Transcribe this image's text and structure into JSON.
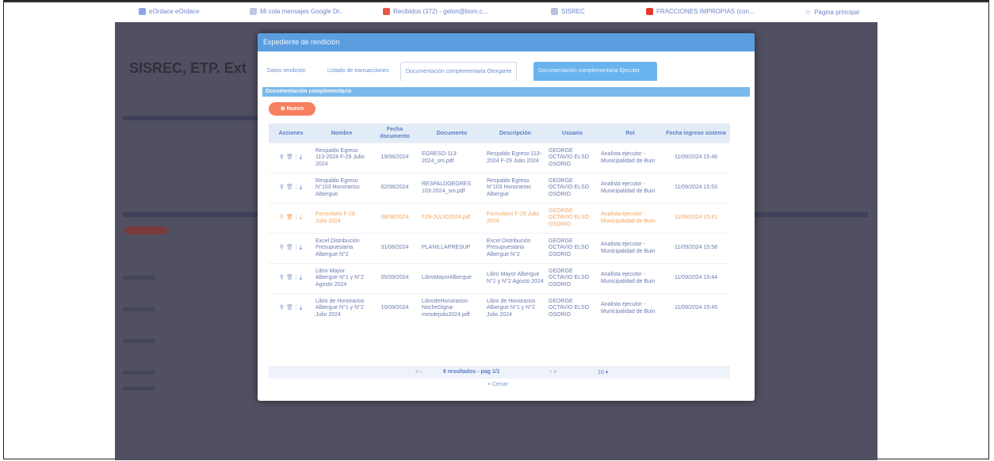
{
  "bookmarks": [
    {
      "label": "eOrdace eOrdace",
      "icon": "folder-icon",
      "color": "#8fa6e6"
    },
    {
      "label": "Mi cola mensajes  Google Dr..",
      "icon": "doc-icon",
      "color": "#c0c8e8"
    },
    {
      "label": "Recibidos (372) - gelon@bom.c...",
      "icon": "mail-icon",
      "color": "#e8584a"
    },
    {
      "label": "SISREC",
      "icon": "link-icon",
      "color": "#b8c2de"
    },
    {
      "label": "FRACCIONES IMPROPIAS (con...",
      "icon": "youtube-icon",
      "color": "#e63a2a"
    },
    {
      "label": "Página principal",
      "icon": "star-icon",
      "color": "#9fb2e6"
    }
  ],
  "backdrop": {
    "title": "SISREC, ETP. Ext"
  },
  "modal": {
    "title": "Expediente de rendición",
    "tabs": [
      {
        "label": "Datos rendición"
      },
      {
        "label": "Listado de transacciones"
      },
      {
        "label": "Documentación complementaria Otorgante"
      },
      {
        "label": "Documentación complementaria Ejecutor"
      }
    ],
    "section_title": "Documentación complementaria",
    "new_button": "Nuevo",
    "table": {
      "headers": [
        "Acciones",
        "Nombre",
        "Fecha documento",
        "Documento",
        "Descripción",
        "Usuario",
        "Rol",
        "Fecha ingreso sistema"
      ],
      "rows": [
        {
          "nombre": "Respaldo Egreso 113-2024 F-29 Julio 2024",
          "fecha": "19/08/2024",
          "documento": "EGRESO-113-2024_sm.pdf",
          "descripcion": "Respaldo Egreso 113-2024 F-29 Julio 2024",
          "usuario": "GEORGE OCTAVIO ELSO OSORIO",
          "rol": "Analista ejecutor - Municipalidad de Buin",
          "ingreso": "11/09/2024 15:46"
        },
        {
          "nombre": "Respaldo Egreso N°103 Honorarios Albergue",
          "fecha": "02/08/2024",
          "documento": "RESPALDOEGRES 103-2024_sm.pdf",
          "descripcion": "Respaldo Egreso N°103 Honorarios Albergue",
          "usuario": "GEORGE OCTAVIO ELSO OSORIO",
          "rol": "Analista ejecutor - Municipalidad de Buin",
          "ingreso": "11/09/2024 15:53"
        },
        {
          "nombre": "Formulario F-29 Julio 2024",
          "fecha": "08/08/2024",
          "documento": "F29-JULIO2024.pdf",
          "descripcion": "Formulario F-29 Julio 2024",
          "usuario": "GEORGE OCTAVIO ELSO OSORIO",
          "rol": "Analista ejecutor - Municipalidad de Buin",
          "ingreso": "11/09/2024 15:41"
        },
        {
          "nombre": "Excel Distribución Presupuestaria Albergue N°2",
          "fecha": "31/08/2024",
          "documento": "PLANILLAPRESUP",
          "descripcion": "Excel Distribución Presupuestaria Albergue N°2",
          "usuario": "GEORGE OCTAVIO ELSO OSORIO",
          "rol": "Analista ejecutor - Municipalidad de Buin",
          "ingreso": "11/09/2024 15:58"
        },
        {
          "nombre": "Libro Mayor Albergue N°1 y N°2 Agosto 2024",
          "fecha": "05/09/2024",
          "documento": "LibroMayorAlbergue",
          "descripcion": "Libro Mayor Albergue N°1 y N°2 Agosto 2024",
          "usuario": "GEORGE OCTAVIO ELSO OSORIO",
          "rol": "Analista ejecutor - Municipalidad de Buin",
          "ingreso": "11/09/2024 15:44"
        },
        {
          "nombre": "Libro de Honorarios Albergue N°1 y N°2 Julio 2024",
          "fecha": "10/09/2024",
          "documento": "LibrodeHonorarios-NocheDigna-mesdejulio2024.pdf",
          "descripcion": "Libro de Honorarios Albergue N°1 y N°2 Julio 2024",
          "usuario": "GEORGE OCTAVIO ELSO OSORIO",
          "rol": "Analista ejecutor - Municipalidad de Buin",
          "ingreso": "11/09/2024 15:45"
        }
      ]
    },
    "pager": {
      "summary": "6 resultados - pag 1/1",
      "page_size": "10"
    },
    "close_button": "Cerrar"
  },
  "colors": {
    "header": "#5b9ee0",
    "active_tab": "#69b3ee",
    "new_button": "#f57f5f",
    "highlight_row": "#f3a45c",
    "backdrop": "#505062"
  }
}
